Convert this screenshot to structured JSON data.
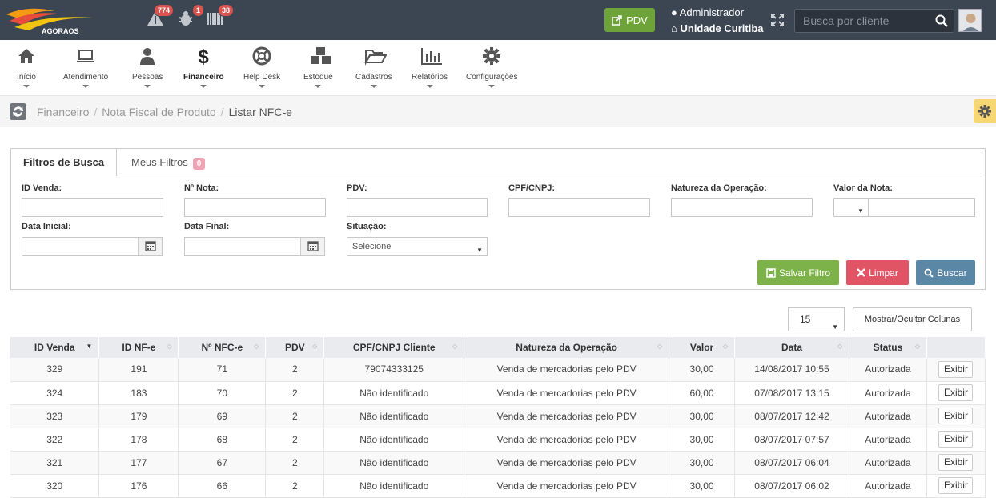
{
  "header": {
    "logo_text": "AGORAOS",
    "alerts": [
      {
        "name": "warning-icon",
        "count": "774"
      },
      {
        "name": "bug-icon",
        "count": "1"
      },
      {
        "name": "barcode-icon",
        "count": "38"
      }
    ],
    "pdv_label": "PDV",
    "user_name": "Administrador",
    "unit_name": "Unidade Curitiba",
    "search_placeholder": "Busca por cliente"
  },
  "menu": [
    {
      "label": "Início",
      "icon": "home-icon"
    },
    {
      "label": "Atendimento",
      "icon": "laptop-icon"
    },
    {
      "label": "Pessoas",
      "icon": "user-icon"
    },
    {
      "label": "Financeiro",
      "icon": "dollar-icon",
      "active": true
    },
    {
      "label": "Help Desk",
      "icon": "lifebuoy-icon"
    },
    {
      "label": "Estoque",
      "icon": "cubes-icon"
    },
    {
      "label": "Cadastros",
      "icon": "folder-open-icon"
    },
    {
      "label": "Relatórios",
      "icon": "bar-chart-icon"
    },
    {
      "label": "Configurações",
      "icon": "gear-icon"
    }
  ],
  "breadcrumb": [
    "Financeiro",
    "Nota Fiscal de Produto",
    "Listar NFC-e"
  ],
  "tabs": {
    "search_filters": "Filtros de Busca",
    "my_filters": "Meus Filtros",
    "my_filters_count": "0"
  },
  "filters": {
    "id_venda": "ID Venda:",
    "nr_nota": "Nº Nota:",
    "pdv": "PDV:",
    "cpf_cnpj": "CPF/CNPJ:",
    "natureza": "Natureza da Operação:",
    "valor_nota": "Valor da Nota:",
    "data_inicial": "Data Inicial:",
    "data_final": "Data Final:",
    "situacao": "Situação:",
    "situacao_value": "Selecione"
  },
  "buttons": {
    "save_filter": "Salvar Filtro",
    "clear": "Limpar",
    "search": "Buscar",
    "page_size": "15",
    "toggle_columns": "Mostrar/Ocultar Colunas",
    "row_action": "Exibir"
  },
  "table": {
    "columns": [
      "ID Venda",
      "ID NF-e",
      "Nº NFC-e",
      "PDV",
      "CPF/CNPJ Cliente",
      "Natureza da Operação",
      "Valor",
      "Data",
      "Status",
      ""
    ],
    "rows": [
      [
        "329",
        "191",
        "71",
        "2",
        "79074333125",
        "Venda de mercadorias pelo PDV",
        "30,00",
        "14/08/2017 10:55",
        "Autorizada"
      ],
      [
        "324",
        "183",
        "70",
        "2",
        "Não identificado",
        "Venda de mercadorias pelo PDV",
        "60,00",
        "07/08/2017 13:15",
        "Autorizada"
      ],
      [
        "323",
        "179",
        "69",
        "2",
        "Não identificado",
        "Venda de mercadorias pelo PDV",
        "30,00",
        "08/07/2017 12:42",
        "Autorizada"
      ],
      [
        "322",
        "178",
        "68",
        "2",
        "Não identificado",
        "Venda de mercadorias pelo PDV",
        "30,00",
        "08/07/2017 07:57",
        "Autorizada"
      ],
      [
        "321",
        "177",
        "67",
        "2",
        "Não identificado",
        "Venda de mercadorias pelo PDV",
        "30,00",
        "08/07/2017 06:04",
        "Autorizada"
      ],
      [
        "320",
        "176",
        "66",
        "2",
        "Não identificado",
        "Venda de mercadorias pelo PDV",
        "30,00",
        "08/07/2017 06:02",
        "Autorizada"
      ]
    ]
  },
  "colors": {
    "topbar": "#3c4653",
    "pdv_green": "#6ea33a",
    "save_green": "#7db24a",
    "clear_red": "#e05465",
    "search_blue": "#5a87a6",
    "badge_red": "#d9534f"
  }
}
